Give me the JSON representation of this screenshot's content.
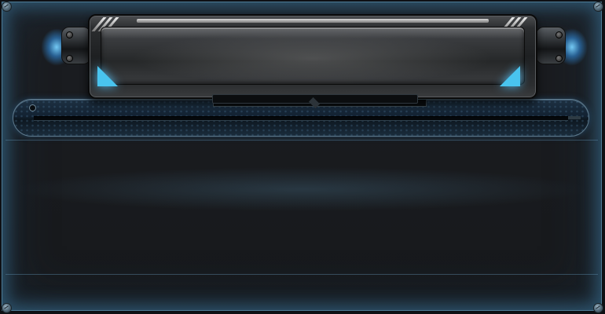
{
  "window": {
    "title": ""
  },
  "colors": {
    "frame_border": "#4d7b96",
    "panel_background": "#1a1c1f",
    "accent_glow": "#49c4ef",
    "rail": "#132232"
  },
  "icons": {
    "corner_rivets": [
      "rivet-icon",
      "rivet-icon",
      "rivet-icon",
      "rivet-icon"
    ],
    "capsule_lights": [
      "blue-light-left-icon",
      "blue-light-right-icon"
    ]
  }
}
